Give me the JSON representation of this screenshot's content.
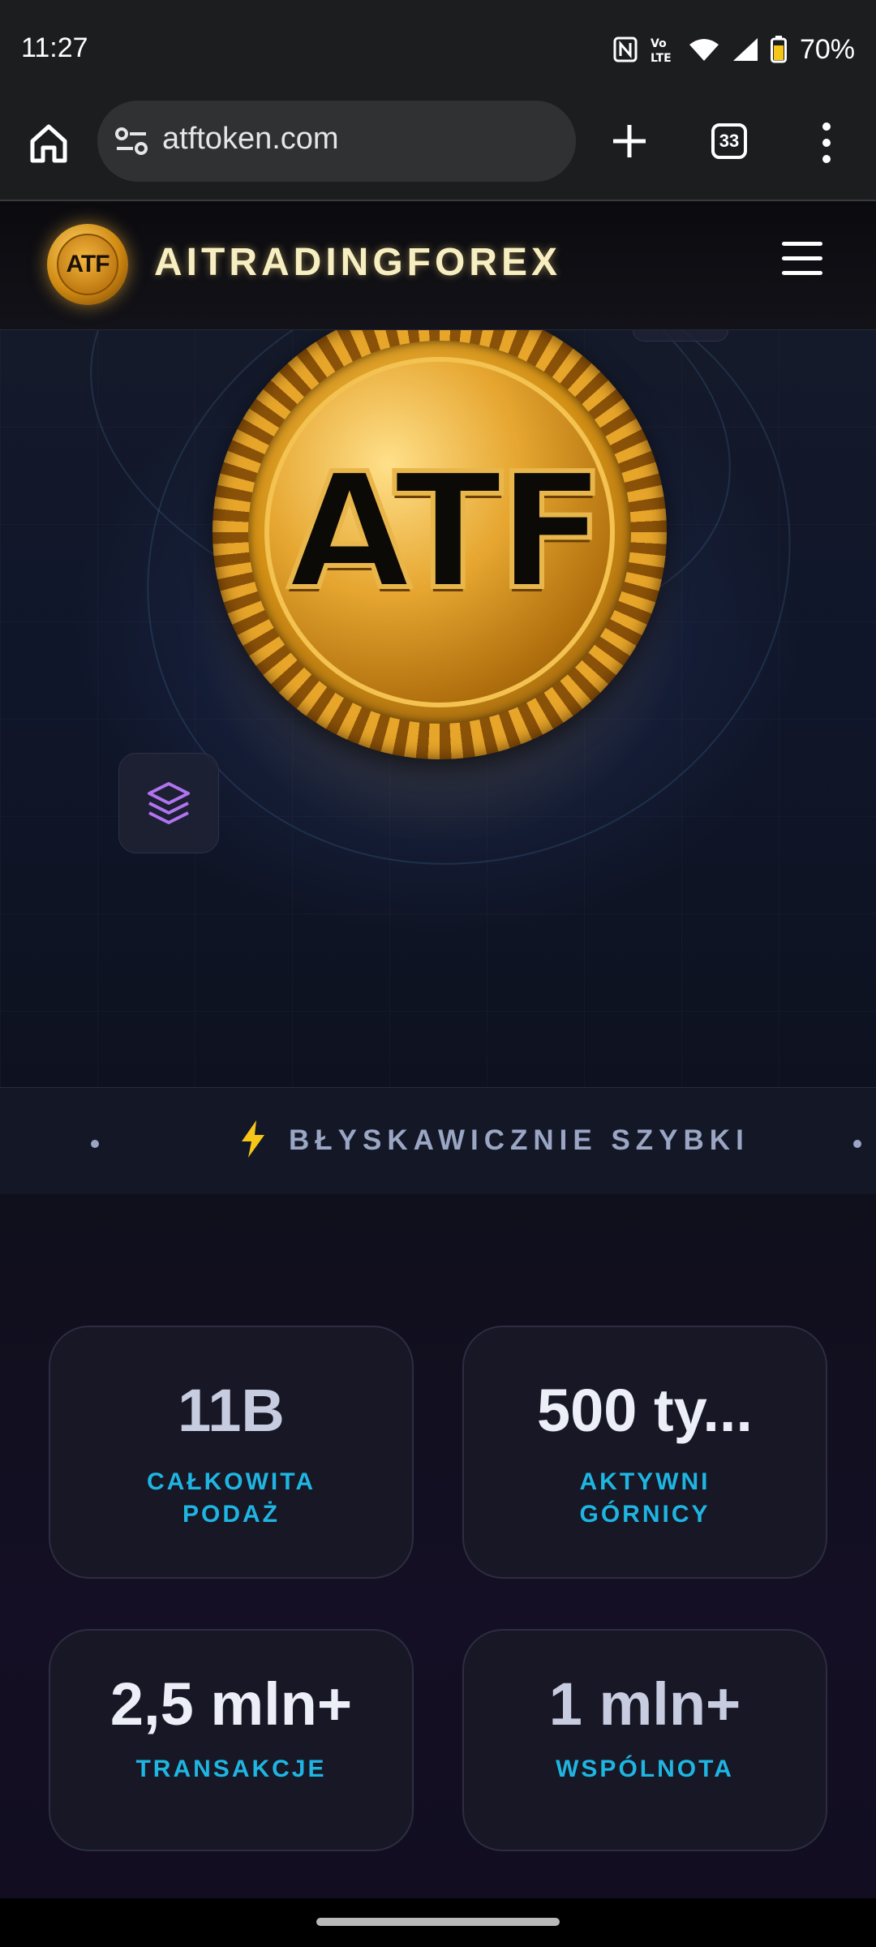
{
  "status_bar": {
    "time": "11:27",
    "battery": "70%",
    "icons": [
      "nfc-icon",
      "volte-icon",
      "wifi-icon",
      "signal-icon",
      "battery-icon"
    ]
  },
  "browser": {
    "url": "atftoken.com",
    "tab_count": "33",
    "icons": [
      "home-icon",
      "site-info-icon",
      "new-tab-icon",
      "tab-switcher-icon",
      "more-menu-icon"
    ]
  },
  "site_header": {
    "logo_text": "ATF",
    "brand": "AITRADINGFOREX",
    "menu_icon": "hamburger-menu-icon"
  },
  "hero": {
    "coin_text": "ATF",
    "layers_icon": "layers-icon"
  },
  "ticker": {
    "label": "BŁYSKAWICZNIE SZYBKI",
    "icon": "lightning-bolt-icon"
  },
  "stats": [
    {
      "value": "11B",
      "label": "CAŁKOWITA PODAŻ"
    },
    {
      "value": "500 ty...",
      "label": "AKTYWNI GÓRNICY"
    },
    {
      "value": "2,5 mln+",
      "label": "TRANSAKCJE"
    },
    {
      "value": "1 mln+",
      "label": "WSPÓLNOTA"
    }
  ],
  "colors": {
    "accent_cyan": "#1fb5e2",
    "gold": "#e6a630",
    "background": "#0d0d18"
  }
}
